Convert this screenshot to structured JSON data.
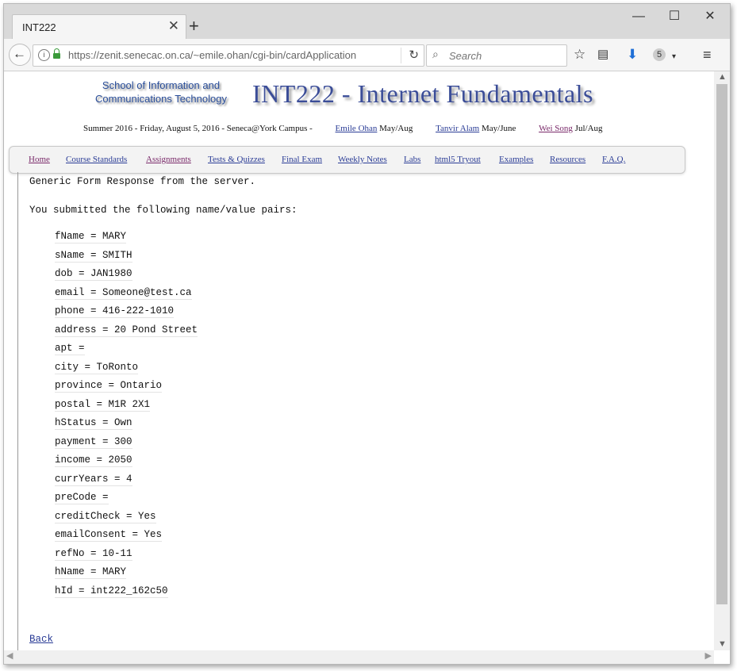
{
  "browser": {
    "tab_title": "INT222",
    "tab_close": "✕",
    "new_tab": "+",
    "window_controls": {
      "minimize": "—",
      "maximize": "☐",
      "close": "✕"
    },
    "url": "https://zenit.senecac.on.ca/~emile.ohan/cgi-bin/cardApplication",
    "search_placeholder": "Search",
    "icons": [
      "back-arrow-icon",
      "info-icon",
      "lock-icon",
      "reload-icon",
      "search-icon",
      "bookmark-star-icon",
      "reading-list-icon",
      "download-icon",
      "extension-icon",
      "menu-icon"
    ],
    "extension_badge": "5"
  },
  "header": {
    "school": "School of Information and Communications Technology",
    "course_title": "INT222 - Internet Fundamentals",
    "term": "Summer 2016 - Friday, August 5, 2016 - Seneca@York Campus -",
    "instructors": [
      {
        "name": "Emile Ohan",
        "period": "May/Aug"
      },
      {
        "name": "Tanvir Alam",
        "period": "May/June"
      },
      {
        "name": "Wei Song",
        "period": "Jul/Aug"
      }
    ]
  },
  "nav": [
    "Home",
    "Course Standards",
    "Assignments",
    "Tests & Quizzes",
    "Final Exam",
    "Weekly Notes",
    "Labs",
    "html5 Tryout",
    "Examples",
    "Resources",
    "F.A.Q."
  ],
  "main": {
    "intro": "Generic Form Response from the server.",
    "submitted": "You submitted the following name/value pairs:",
    "pairs": [
      "fName = MARY",
      "sName = SMITH",
      "dob = JAN1980",
      "email = Someone@test.ca",
      "phone = 416-222-1010",
      "address = 20 Pond Street",
      "apt =",
      "city = ToRonto",
      "province = Ontario",
      "postal = M1R 2X1",
      "hStatus = Own",
      "payment = 300",
      "income = 2050",
      "currYears = 4",
      "preCode =",
      "creditCheck = Yes",
      "emailConsent = Yes",
      "refNo = 10-11",
      "hName = MARY",
      "hId = int222_162c50"
    ],
    "back_link": "Back"
  }
}
